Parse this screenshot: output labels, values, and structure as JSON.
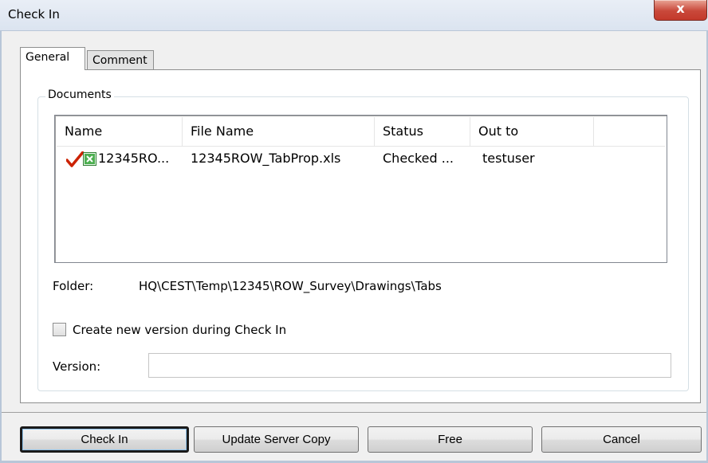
{
  "window": {
    "title": "Check In",
    "close_label": "x"
  },
  "tabs": [
    {
      "label": "General",
      "active": true
    },
    {
      "label": "Comment",
      "active": false
    }
  ],
  "documents": {
    "group_label": "Documents",
    "columns": [
      "Name",
      "File Name",
      "Status",
      "Out to"
    ],
    "rows": [
      {
        "checked": true,
        "icon": "excel-file-icon",
        "name": "12345RO...",
        "file_name": "12345ROW_TabProp.xls",
        "status": "Checked ...",
        "out_to": "testuser"
      }
    ]
  },
  "folder": {
    "label": "Folder:",
    "value": "HQ\\CEST\\Temp\\12345\\ROW_Survey\\Drawings\\Tabs"
  },
  "create_version": {
    "label": "Create new version during Check In",
    "checked": false
  },
  "version": {
    "label": "Version:",
    "value": ""
  },
  "buttons": {
    "check_in": "Check In",
    "update_server_copy": "Update Server Copy",
    "free": "Free",
    "cancel": "Cancel"
  },
  "colors": {
    "checkmark": "#cc2200",
    "excel": "#2e7d32",
    "titlebar": "#dbe4f0",
    "close": "#c9483a"
  }
}
